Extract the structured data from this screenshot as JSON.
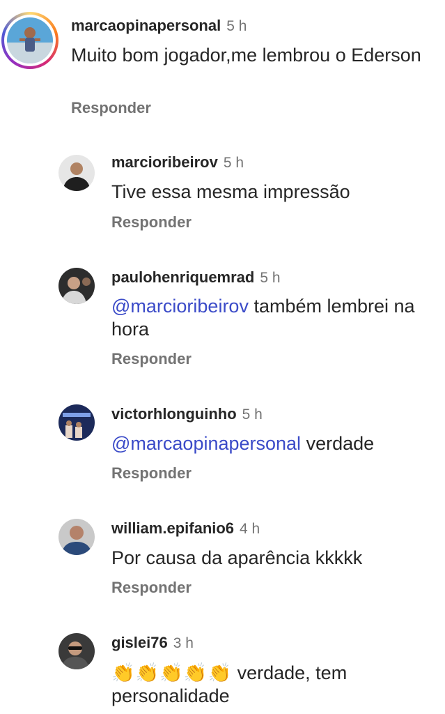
{
  "comments": [
    {
      "username": "marcaopinapersonal",
      "time": "5 h",
      "text": "Muito bom jogador,me lembrou o Ederson",
      "reply": "Responder"
    },
    {
      "username": "marcioribeirov",
      "time": "5 h",
      "text": "Tive essa mesma impressão",
      "reply": "Responder"
    },
    {
      "username": "paulohenriquemrad",
      "time": "5 h",
      "mention": "@marcioribeirov",
      "text": " também lembrei na hora",
      "reply": "Responder"
    },
    {
      "username": "victorhlonguinho",
      "time": "5 h",
      "mention": "@marcaopinapersonal",
      "text": " verdade",
      "reply": "Responder"
    },
    {
      "username": "william.epifanio6",
      "time": "4 h",
      "text": "Por causa da aparência kkkkk",
      "reply": "Responder"
    },
    {
      "username": "gislei76",
      "time": "3 h",
      "emoji": "👏👏👏👏👏",
      "text": " verdade, tem personalidade"
    }
  ],
  "icons": {
    "mention_prefix": "threads-icon",
    "emoji": "clapping-hands-icon"
  },
  "colors": {
    "mention": "#3b4bc8",
    "meta": "#737373",
    "text": "#262626"
  }
}
